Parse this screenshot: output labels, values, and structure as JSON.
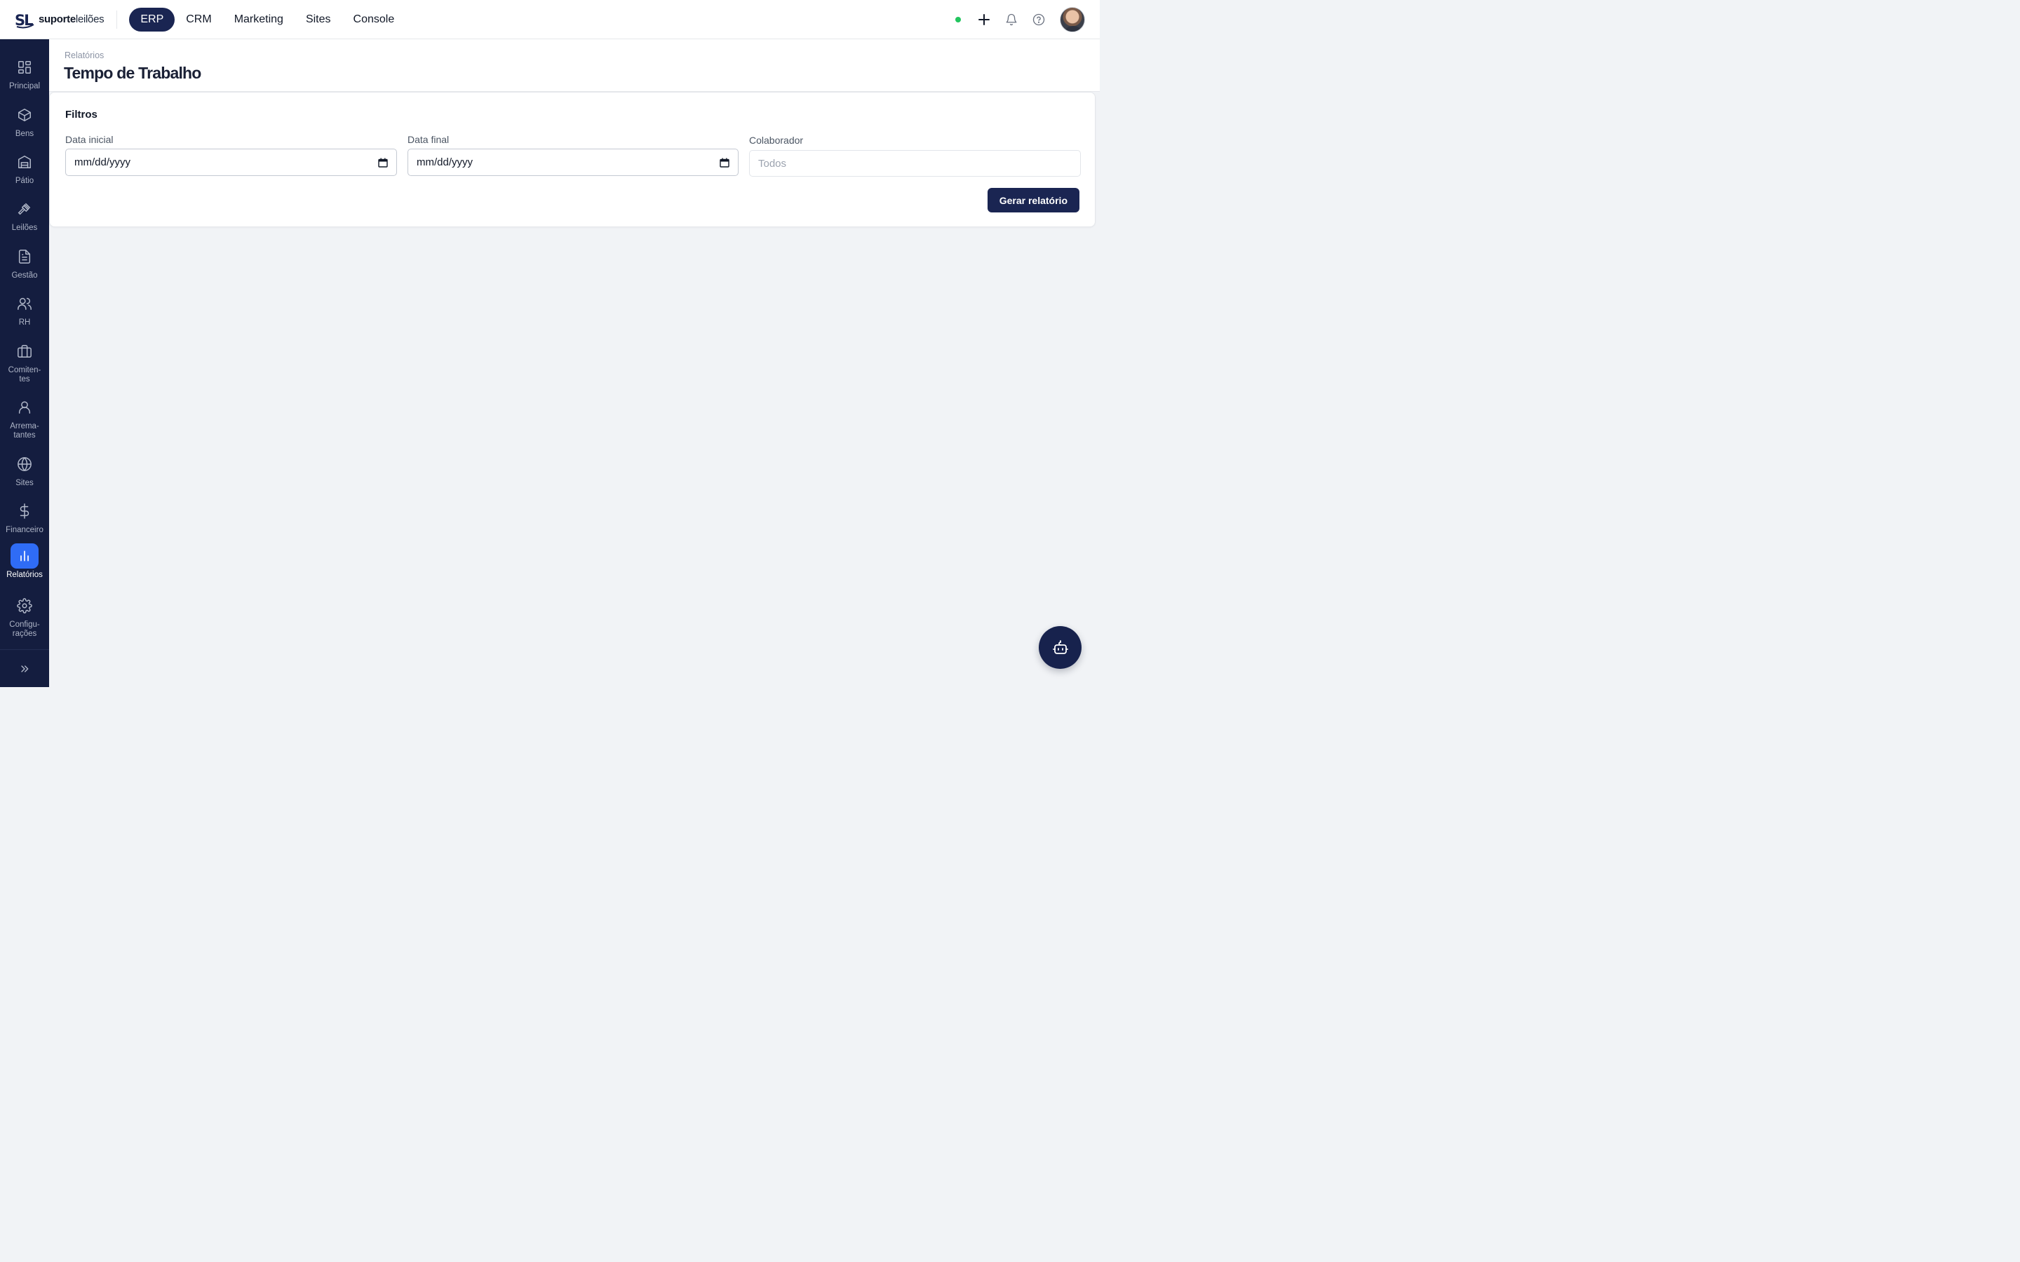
{
  "brand": {
    "logo_mark": "SL",
    "name_bold": "suporte",
    "name_light": "leilões"
  },
  "topnav": {
    "items": [
      {
        "label": "ERP",
        "active": true
      },
      {
        "label": "CRM",
        "active": false
      },
      {
        "label": "Marketing",
        "active": false
      },
      {
        "label": "Sites",
        "active": false
      },
      {
        "label": "Console",
        "active": false
      }
    ]
  },
  "topright": {
    "status": "online",
    "status_color": "#22c55e",
    "icons": [
      "plus-icon",
      "bell-icon",
      "help-icon"
    ]
  },
  "sidebar": {
    "items": [
      {
        "label": "Principal",
        "icon": "dashboard-icon"
      },
      {
        "label": "Bens",
        "icon": "box-icon"
      },
      {
        "label": "Pátio",
        "icon": "warehouse-icon"
      },
      {
        "label": "Leilões",
        "icon": "gavel-icon"
      },
      {
        "label": "Gestão",
        "icon": "document-icon"
      },
      {
        "label": "RH",
        "icon": "users-icon"
      },
      {
        "label": "Comiten-\ntes",
        "icon": "briefcase-icon"
      },
      {
        "label": "Arrema-\ntantes",
        "icon": "user-icon"
      },
      {
        "label": "Sites",
        "icon": "globe-icon"
      },
      {
        "label": "Financeiro",
        "icon": "dollar-icon"
      },
      {
        "label": "Relatórios",
        "icon": "bar-chart-icon",
        "active": true
      },
      {
        "label": "Configu-\nrações",
        "icon": "gear-icon"
      }
    ],
    "collapse_icon": "chevrons-right-icon"
  },
  "page": {
    "breadcrumb": "Relatórios",
    "title": "Tempo de Trabalho"
  },
  "filters": {
    "title": "Filtros",
    "start_date": {
      "label": "Data inicial",
      "value": "mm/dd/yyyy"
    },
    "end_date": {
      "label": "Data final",
      "value": "mm/dd/yyyy"
    },
    "collaborator": {
      "label": "Colaborador",
      "placeholder": "Todos"
    },
    "submit_label": "Gerar relatório"
  },
  "assistant": {
    "icon": "robot-icon"
  },
  "colors": {
    "sidebar_bg": "#141d3f",
    "primary": "#1a2552",
    "active_accent": "#2f6cf6"
  }
}
